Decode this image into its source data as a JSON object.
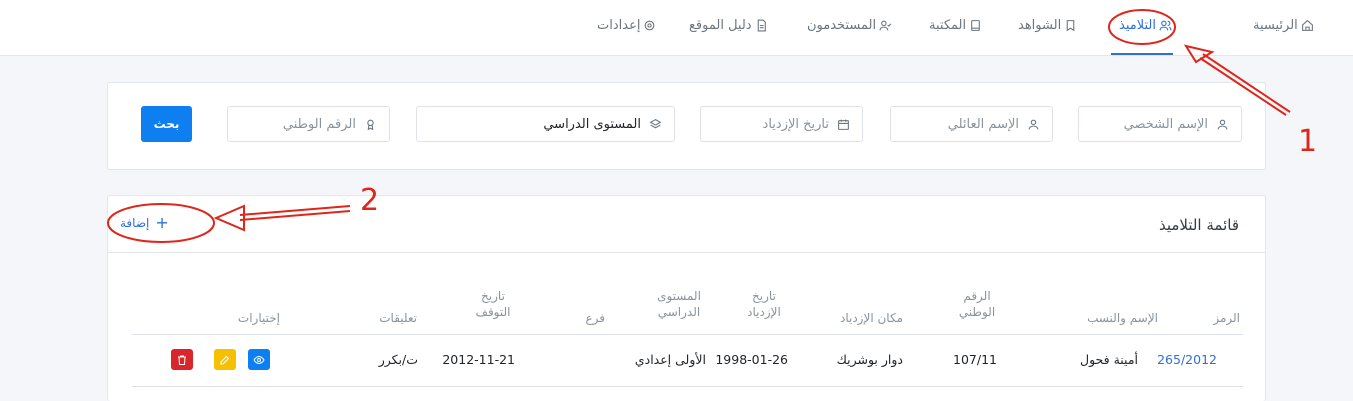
{
  "nav": {
    "items": [
      {
        "label": "الرئيسية",
        "icon": "home-icon",
        "active": false
      },
      {
        "label": "التلاميذ",
        "icon": "users-icon",
        "active": true
      },
      {
        "label": "الشواهد",
        "icon": "bookmark-icon",
        "active": false
      },
      {
        "label": "المكتبة",
        "icon": "book-icon",
        "active": false
      },
      {
        "label": "المستخدمون",
        "icon": "user-check-icon",
        "active": false
      },
      {
        "label": "دليل الموقع",
        "icon": "file-text-icon",
        "active": false
      },
      {
        "label": "إعدادات",
        "icon": "settings-icon",
        "active": false
      }
    ],
    "accent": "#2f6fd6"
  },
  "filters": {
    "first_name_placeholder": "الإسم الشخصي",
    "family_name_placeholder": "الإسم العائلي",
    "birth_date_placeholder": "تاريخ الإزدياد",
    "level_selected": "المستوى الدراسي",
    "national_id_placeholder": "الرقم الوطني",
    "search_label": "بحث"
  },
  "list": {
    "title": "قائمة التلاميذ",
    "add_label": "إضافة",
    "columns": [
      "الرمز",
      "الإسم والنسب",
      "الرقم الوطني",
      "مكان الإزدياد",
      "تاريخ الإزدياد",
      "المستوى الدراسي",
      "فرع",
      "تاريخ التوقف",
      "تعليقات",
      "إختيارات"
    ],
    "rows": [
      {
        "code": "265/2012",
        "name": "أمينة فحول",
        "national_id": "107/11",
        "birth_place": "دوار بوشريك",
        "birth_date": "1998-01-26",
        "level": "الأولى إعدادي",
        "branch": "",
        "stop_date": "2012-11-21",
        "comments": "ت/بكرر"
      }
    ]
  },
  "annotations": {
    "marker_1": "1",
    "marker_2": "2",
    "color": "#e0251b"
  }
}
